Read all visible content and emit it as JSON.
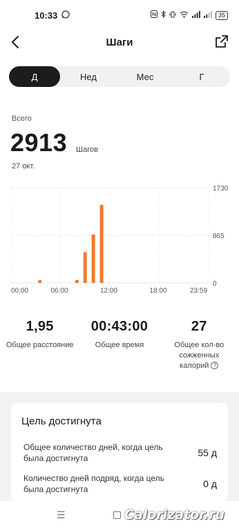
{
  "status_bar": {
    "time": "10:33",
    "battery": "35"
  },
  "header": {
    "title": "Шаги"
  },
  "tabs": [
    {
      "label": "Д",
      "active": true
    },
    {
      "label": "Нед",
      "active": false
    },
    {
      "label": "Мес",
      "active": false
    },
    {
      "label": "Г",
      "active": false
    }
  ],
  "summary": {
    "label": "Всего",
    "value": "2913",
    "unit": "Шагов",
    "date": "27 окт."
  },
  "chart_data": {
    "type": "bar",
    "color": "#f07a2c",
    "xlim": [
      0,
      24
    ],
    "ylim": [
      0,
      1730
    ],
    "y_ticks": [
      "1730",
      "865",
      "0"
    ],
    "y_tick_values": [
      1730,
      865,
      0
    ],
    "x_ticks": [
      "00:00",
      "06:00",
      "12:00",
      "18:00",
      "23:59"
    ],
    "x_tick_values": [
      0,
      6,
      12,
      18,
      24
    ],
    "x": [
      3.5,
      8,
      9,
      10,
      11
    ],
    "values": [
      50,
      55,
      560,
      880,
      1420
    ]
  },
  "stats": [
    {
      "value": "1,95",
      "label": "Общее расстояние"
    },
    {
      "value": "00:43:00",
      "label": "Общее время"
    },
    {
      "value": "27",
      "label": "Общее кол-во сожженных калорий",
      "help": "?"
    }
  ],
  "goal": {
    "title": "Цель достигнута",
    "rows": [
      {
        "text": "Общее количество дней, когда цель была достигнута",
        "value": "55 д"
      },
      {
        "text": "Количество дней подряд, когда цель была достигнута",
        "value": "0 д"
      }
    ]
  },
  "navbar": {
    "menu_icon": "menu-icon",
    "home_icon": "home-icon"
  },
  "watermark": "Calorizator.ru",
  "colors": {
    "accent": "#f07a2c",
    "tab_active": "#1c1c1c"
  }
}
